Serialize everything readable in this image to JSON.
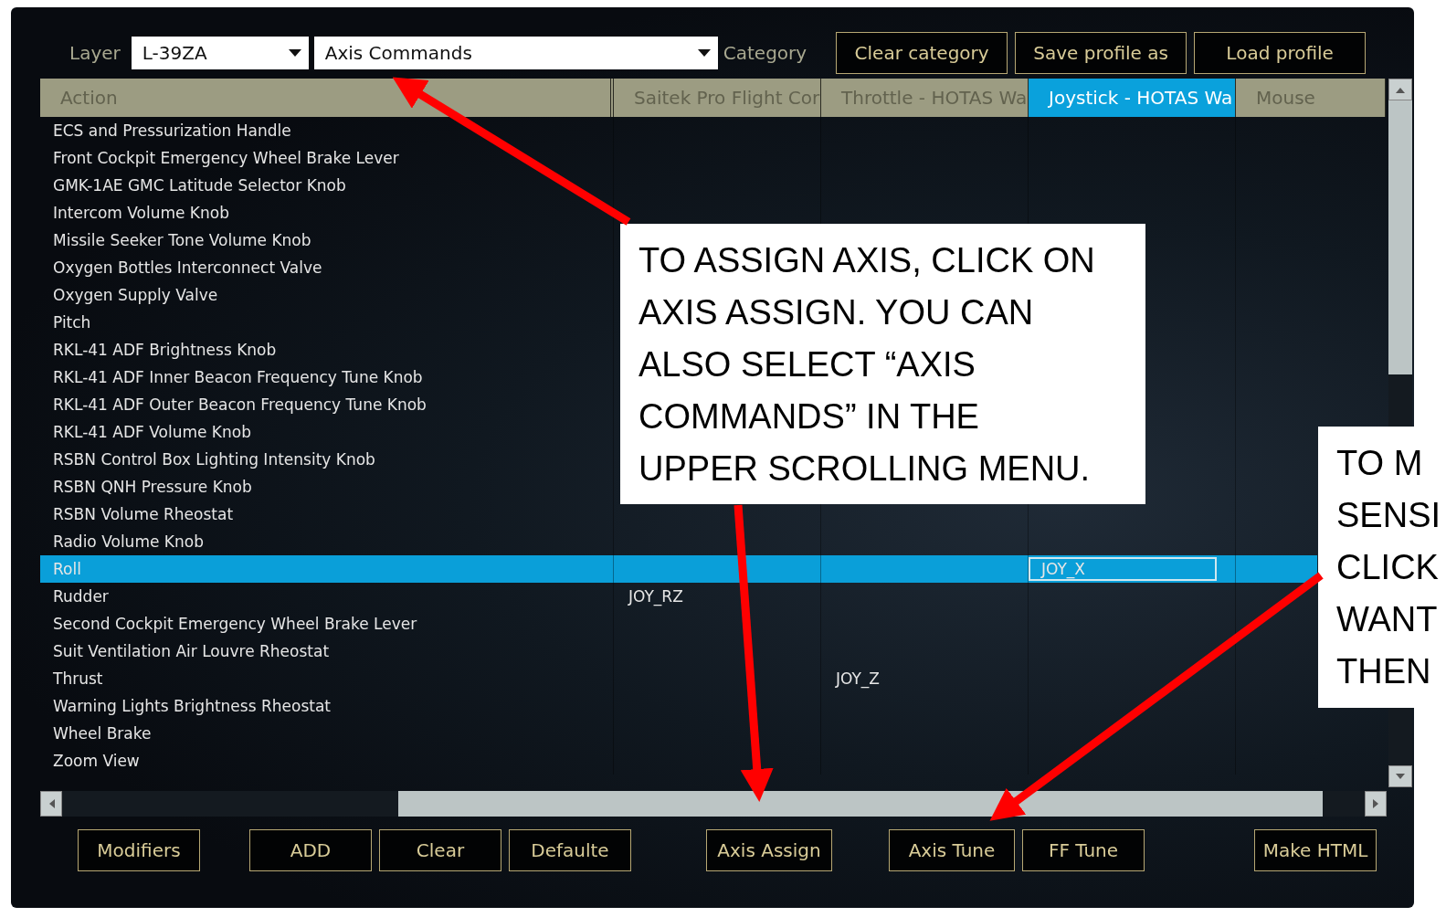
{
  "toolbar": {
    "layer_label": "Layer",
    "layer_value": "L-39ZA",
    "category_value": "Axis Commands",
    "category_label": "Category",
    "buttons": [
      "Clear category",
      "Save profile as",
      "Load profile"
    ]
  },
  "table": {
    "columns": [
      {
        "label": "Action",
        "selected": false
      },
      {
        "label": "Saitek Pro Flight Cor",
        "selected": false
      },
      {
        "label": "Throttle - HOTAS Wa",
        "selected": false
      },
      {
        "label": "Joystick - HOTAS Wa",
        "selected": true
      },
      {
        "label": "Mouse",
        "selected": false
      }
    ],
    "rows": [
      {
        "action": "ECS and Pressurization Handle",
        "selected": false
      },
      {
        "action": "Front Cockpit Emergency Wheel Brake Lever",
        "selected": false
      },
      {
        "action": "GMK-1AE GMC Latitude Selector Knob",
        "selected": false
      },
      {
        "action": "Intercom Volume Knob",
        "selected": false
      },
      {
        "action": "Missile Seeker Tone Volume Knob",
        "selected": false
      },
      {
        "action": "Oxygen Bottles Interconnect Valve",
        "selected": false
      },
      {
        "action": "Oxygen Supply Valve",
        "selected": false
      },
      {
        "action": "Pitch",
        "selected": false
      },
      {
        "action": "RKL-41 ADF Brightness Knob",
        "selected": false
      },
      {
        "action": "RKL-41 ADF Inner Beacon Frequency Tune Knob",
        "selected": false
      },
      {
        "action": "RKL-41 ADF Outer Beacon Frequency Tune Knob",
        "selected": false
      },
      {
        "action": "RKL-41 ADF Volume Knob",
        "selected": false
      },
      {
        "action": "RSBN Control Box Lighting Intensity Knob",
        "selected": false
      },
      {
        "action": "RSBN QNH Pressure Knob",
        "selected": false
      },
      {
        "action": "RSBN Volume Rheostat",
        "selected": false
      },
      {
        "action": "Radio Volume Knob",
        "selected": false
      },
      {
        "action": "Roll",
        "selected": true,
        "column_4": "JOY_X"
      },
      {
        "action": "Rudder",
        "selected": false,
        "column_2": "JOY_RZ"
      },
      {
        "action": "Second Cockpit Emergency Wheel Brake Lever",
        "selected": false
      },
      {
        "action": "Suit Ventilation Air Louvre Rheostat",
        "selected": false
      },
      {
        "action": "Thrust",
        "selected": false,
        "column_3": "JOY_Z"
      },
      {
        "action": "Warning Lights Brightness Rheostat",
        "selected": false
      },
      {
        "action": "Wheel Brake",
        "selected": false
      },
      {
        "action": "Zoom View",
        "selected": false
      }
    ]
  },
  "bottom_buttons": [
    "Modifiers",
    "ADD",
    "Clear",
    "Defaulte",
    "Axis Assign",
    "Axis Tune",
    "FF Tune",
    "Make HTML"
  ],
  "callouts": [
    {
      "lines": [
        "TO ASSIGN AXIS, CLICK ON",
        "AXIS ASSIGN. YOU CAN",
        "ALSO SELECT “AXIS",
        "COMMANDS” IN THE",
        "UPPER SCROLLING MENU."
      ]
    },
    {
      "lines": [
        "TO M",
        "SENSI",
        "CLICK",
        "WANT",
        "THEN"
      ]
    }
  ]
}
